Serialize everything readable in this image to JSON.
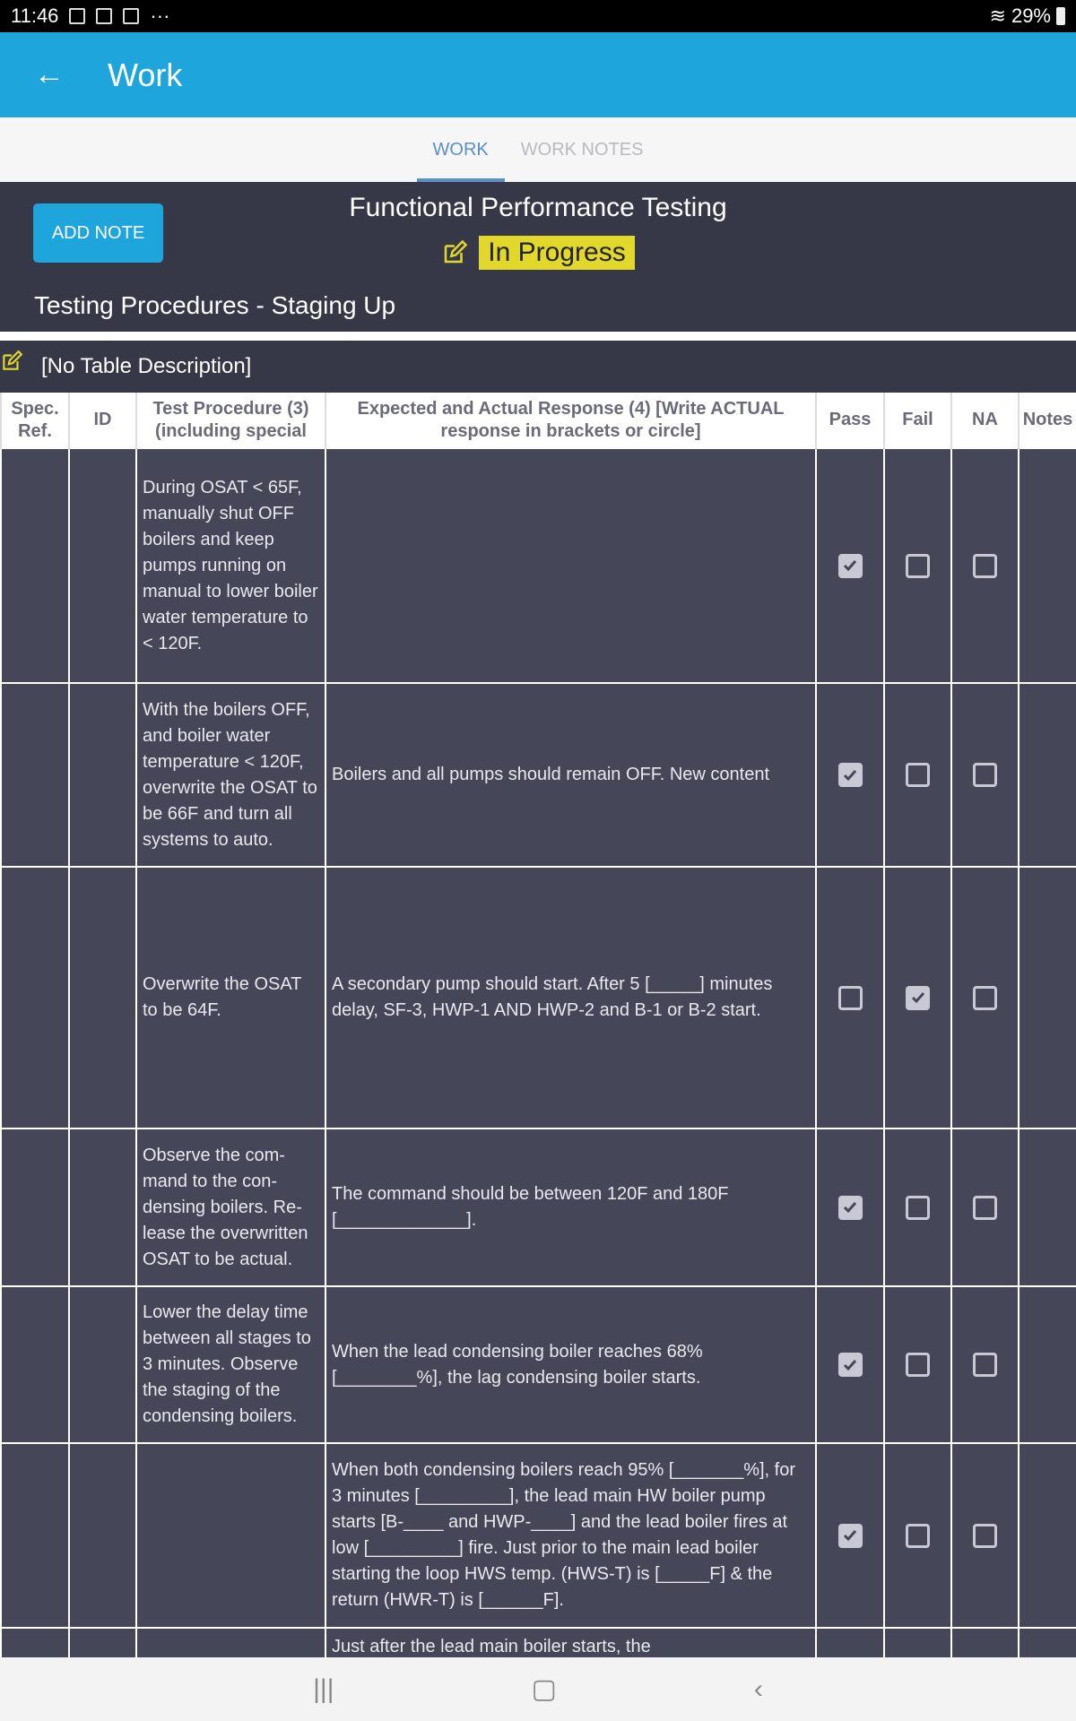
{
  "status_bar": {
    "time": "11:46",
    "battery": "29%"
  },
  "app_bar": {
    "title": "Work"
  },
  "tabs": [
    {
      "label": "WORK",
      "active": true
    },
    {
      "label": "WORK NOTES",
      "active": false
    }
  ],
  "header": {
    "add_note_label": "ADD NOTE",
    "title": "Functional Performance Testing",
    "status": "In Progress",
    "section": "Testing Procedures - Staging Up",
    "status_color": "#e2d82b"
  },
  "table": {
    "description": "[No Table Description]",
    "columns": [
      "Spec. Ref.",
      "ID",
      "Test Procedure (3) (including special",
      "Expected and Actual Response (4) [Write ACTUAL response in brackets or circle]",
      "Pass",
      "Fail",
      "NA",
      "Notes"
    ],
    "rows": [
      {
        "spec": "",
        "id": "",
        "procedure": "During OSAT < 65F, manually shut OFF boilers and keep pumps running on manual to lower boiler water temperature to < 120F.",
        "response": "",
        "pass": true,
        "fail": false,
        "na": false
      },
      {
        "spec": "",
        "id": "",
        "procedure": "With the boilers OFF, and boiler water temperature < 120F, overwrite the OSAT to be 66F and turn all systems to auto.",
        "response": "Boilers and all pumps should remain OFF. New content",
        "pass": true,
        "fail": false,
        "na": false
      },
      {
        "spec": "",
        "id": "",
        "procedure": "Overwrite the OSAT to be 64F.",
        "response": "A secondary pump should start.  After 5 [_____] minutes delay, SF-3, HWP-1 AND HWP-2 and B-1 or B-2 start.",
        "pass": false,
        "fail": true,
        "na": false
      },
      {
        "spec": "",
        "id": "",
        "procedure": "Observe the com-mand to the con-densing boilers.  Re-lease the overwritten OSAT to be actual.",
        "response": "The command should be between 120F and 180F [_____________].",
        "pass": true,
        "fail": false,
        "na": false
      },
      {
        "spec": "",
        "id": "",
        "procedure": "Lower the delay time between all stages to 3 minutes. Observe the staging of the condensing boilers.",
        "response": "When the lead condensing boiler reaches 68% [________%], the lag condensing boiler starts.",
        "pass": true,
        "fail": false,
        "na": false
      },
      {
        "spec": "",
        "id": "",
        "procedure": "",
        "response": "When both condensing boilers reach 95% [_______%], for 3 minutes [_________], the lead main HW boiler pump starts [B-____ and HWP-____] and the lead boiler fires at low [_________] fire.  Just prior to the main lead boiler starting the loop HWS temp. (HWS-T) is [_____F] & the return (HWR-T) is [______F].",
        "pass": true,
        "fail": false,
        "na": false
      },
      {
        "spec": "",
        "id": "",
        "procedure": "",
        "response": "Just after the lead main boiler starts, the",
        "pass": null,
        "fail": null,
        "na": null
      }
    ]
  }
}
